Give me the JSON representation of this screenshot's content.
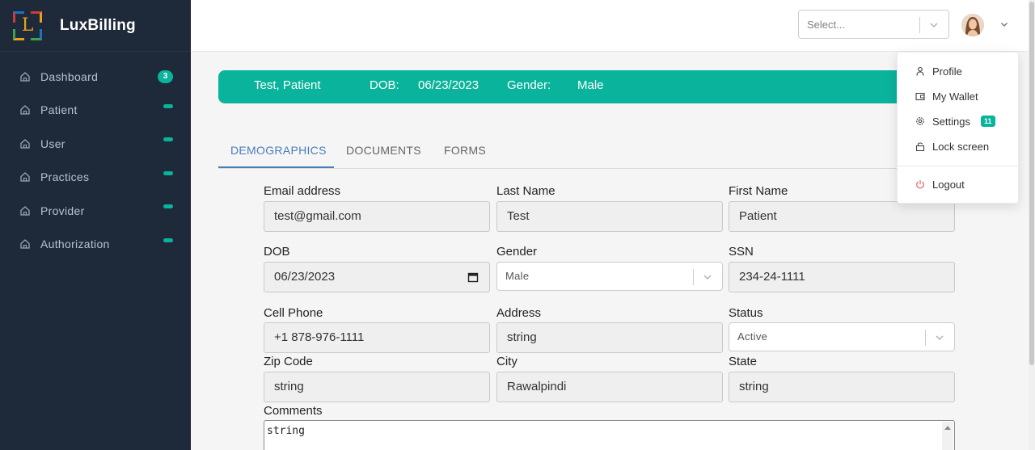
{
  "app": {
    "name": "LuxBilling",
    "logo_letter": "L"
  },
  "sidebar": {
    "items": [
      {
        "label": "Dashboard",
        "badge": "3"
      },
      {
        "label": "Patient"
      },
      {
        "label": "User"
      },
      {
        "label": "Practices"
      },
      {
        "label": "Provider"
      },
      {
        "label": "Authorization"
      }
    ]
  },
  "header": {
    "select_placeholder": "Select..."
  },
  "banner": {
    "name": "Test, Patient",
    "dob_label": "DOB:",
    "dob_value": "06/23/2023",
    "gender_label": "Gender:",
    "gender_value": "Male"
  },
  "tabs": [
    {
      "label": "DEMOGRAPHICS",
      "active": true
    },
    {
      "label": "DOCUMENTS"
    },
    {
      "label": "FORMS"
    }
  ],
  "form": {
    "email": {
      "label": "Email address",
      "value": "test@gmail.com"
    },
    "last_name": {
      "label": "Last Name",
      "value": "Test"
    },
    "first_name": {
      "label": "First Name",
      "value": "Patient"
    },
    "dob": {
      "label": "DOB",
      "value": "06/23/2023"
    },
    "gender": {
      "label": "Gender",
      "value": "Male"
    },
    "ssn": {
      "label": "SSN",
      "value": "234-24-1111"
    },
    "cell_phone": {
      "label": "Cell Phone",
      "value": "+1 878-976-1111"
    },
    "address": {
      "label": "Address",
      "value": "string"
    },
    "status": {
      "label": "Status",
      "value": "Active"
    },
    "zip": {
      "label": "Zip Code",
      "value": "string"
    },
    "city": {
      "label": "City",
      "value": "Rawalpindi"
    },
    "state": {
      "label": "State",
      "value": "string"
    },
    "comments": {
      "label": "Comments",
      "value": "string"
    }
  },
  "user_menu": {
    "items": [
      {
        "label": "Profile",
        "icon": "user-icon"
      },
      {
        "label": "My Wallet",
        "icon": "wallet-icon"
      },
      {
        "label": "Settings",
        "icon": "gear-icon",
        "badge": "11"
      },
      {
        "label": "Lock screen",
        "icon": "lock-icon"
      },
      {
        "label": "Logout",
        "icon": "power-icon"
      }
    ]
  },
  "colors": {
    "accent": "#0ab39c",
    "sidebar_bg": "#1e2a3a",
    "tab_active": "#4a7dba",
    "logout_icon": "#e8636b"
  }
}
